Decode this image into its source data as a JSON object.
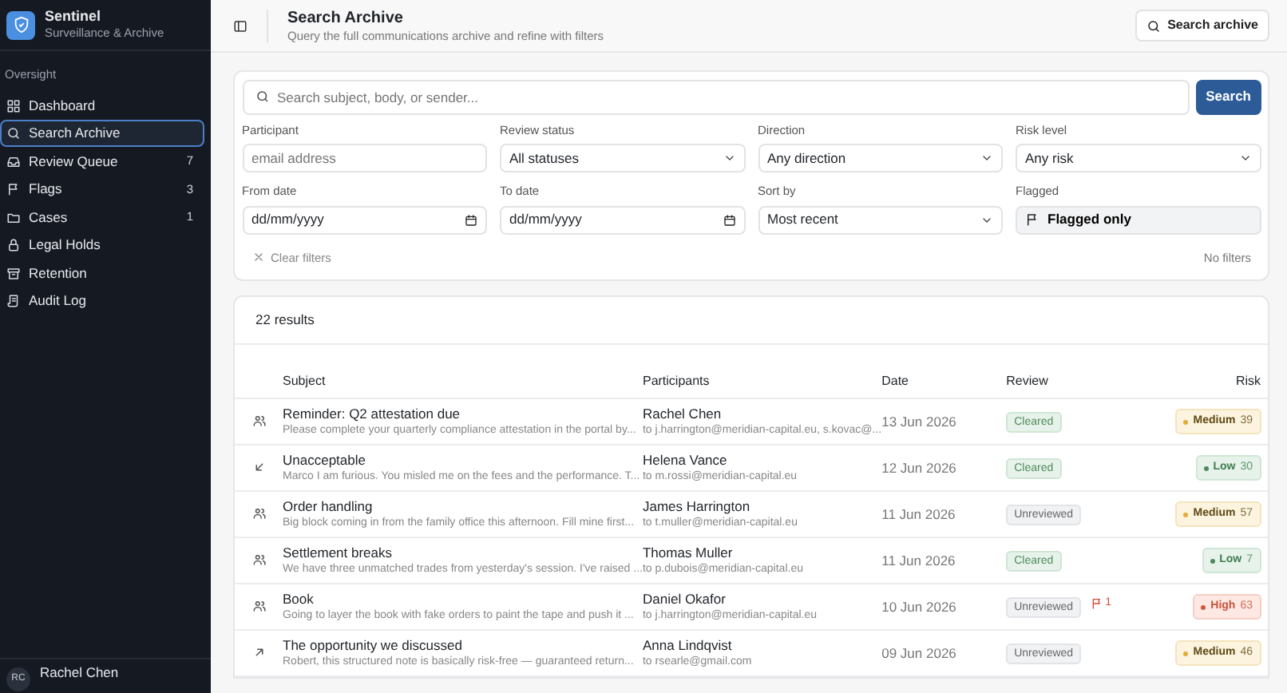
{
  "brand": {
    "name": "Sentinel",
    "tagline": "Surveillance & Archive"
  },
  "sidebar": {
    "section": "Oversight",
    "items": [
      {
        "label": "Dashboard",
        "selected": false
      },
      {
        "label": "Search Archive",
        "selected": true
      },
      {
        "label": "Review Queue",
        "count": "7",
        "selected": false
      },
      {
        "label": "Flags",
        "count": "3",
        "selected": false
      },
      {
        "label": "Cases",
        "count": "1",
        "selected": false
      },
      {
        "label": "Legal Holds",
        "selected": false
      },
      {
        "label": "Retention",
        "selected": false
      },
      {
        "label": "Audit Log",
        "selected": false
      }
    ],
    "user": {
      "initials": "RC",
      "name": "Rachel Chen"
    }
  },
  "header": {
    "title": "Search Archive",
    "subtitle": "Query the full communications archive and refine with filters",
    "action": "Search archive"
  },
  "search": {
    "placeholder": "Search subject, body, or sender...",
    "button": "Search"
  },
  "filters": [
    {
      "label": "Participant",
      "kind": "text",
      "placeholder": "email address"
    },
    {
      "label": "Review status",
      "kind": "select",
      "value": "All statuses"
    },
    {
      "label": "Direction",
      "kind": "select",
      "value": "Any direction"
    },
    {
      "label": "Risk level",
      "kind": "select",
      "value": "Any risk"
    },
    {
      "label": "From date",
      "kind": "date",
      "value": "dd/mm/yyyy"
    },
    {
      "label": "To date",
      "kind": "date",
      "value": "dd/mm/yyyy"
    },
    {
      "label": "Sort by",
      "kind": "select",
      "value": "Most recent"
    },
    {
      "label": "Flagged",
      "kind": "toggle",
      "value": "Flagged only",
      "on": false
    }
  ],
  "clear_filters": "Clear filters",
  "filter_status": "No filters",
  "results": {
    "count": "22 results",
    "columns": [
      "Subject",
      "Participants",
      "Date",
      "Review",
      "Risk"
    ],
    "rows": [
      {
        "kind": "internal",
        "subject": "Reminder: Q2 attestation due",
        "preview": "Please complete your quarterly compliance attestation in the portal by...",
        "sender": "Rachel Chen",
        "to": "to j.harrington@meridian-capital.eu, s.kovac@...",
        "date": "13 Jun 2026",
        "review": {
          "text": "Cleared",
          "kind": "cleared"
        },
        "risk": {
          "text": "Medium",
          "kind": "medium",
          "score": "39"
        }
      },
      {
        "kind": "inbound",
        "subject": "Unacceptable",
        "preview": "Marco I am furious. You misled me on the fees and the performance. T...",
        "sender": "Helena Vance",
        "to": "to m.rossi@meridian-capital.eu",
        "date": "12 Jun 2026",
        "review": {
          "text": "Cleared",
          "kind": "cleared"
        },
        "risk": {
          "text": "Low",
          "kind": "low",
          "score": "30"
        }
      },
      {
        "kind": "internal",
        "subject": "Order handling",
        "preview": "Big block coming in from the family office this afternoon. Fill mine first...",
        "sender": "James Harrington",
        "to": "to t.muller@meridian-capital.eu",
        "date": "11 Jun 2026",
        "review": {
          "text": "Unreviewed",
          "kind": "unreviewed"
        },
        "risk": {
          "text": "Medium",
          "kind": "medium",
          "score": "57"
        }
      },
      {
        "kind": "internal",
        "subject": "Settlement breaks",
        "preview": "We have three unmatched trades from yesterday's session. I've raised ...",
        "sender": "Thomas Muller",
        "to": "to p.dubois@meridian-capital.eu",
        "date": "11 Jun 2026",
        "review": {
          "text": "Cleared",
          "kind": "cleared"
        },
        "risk": {
          "text": "Low",
          "kind": "low",
          "score": "7"
        }
      },
      {
        "kind": "internal",
        "subject": "Book",
        "preview": "Going to layer the book with fake orders to paint the tape and push it ...",
        "sender": "Daniel Okafor",
        "to": "to j.harrington@meridian-capital.eu",
        "date": "10 Jun 2026",
        "review": {
          "text": "Unreviewed",
          "kind": "unreviewed"
        },
        "flags": "1",
        "risk": {
          "text": "High",
          "kind": "high",
          "score": "63"
        }
      },
      {
        "kind": "outbound",
        "subject": "The opportunity we discussed",
        "preview": "Robert, this structured note is basically risk-free — guaranteed return...",
        "sender": "Anna Lindqvist",
        "to": "to rsearle@gmail.com",
        "date": "09 Jun 2026",
        "review": {
          "text": "Unreviewed",
          "kind": "unreviewed"
        },
        "risk": {
          "text": "Medium",
          "kind": "medium",
          "score": "46"
        }
      }
    ]
  }
}
